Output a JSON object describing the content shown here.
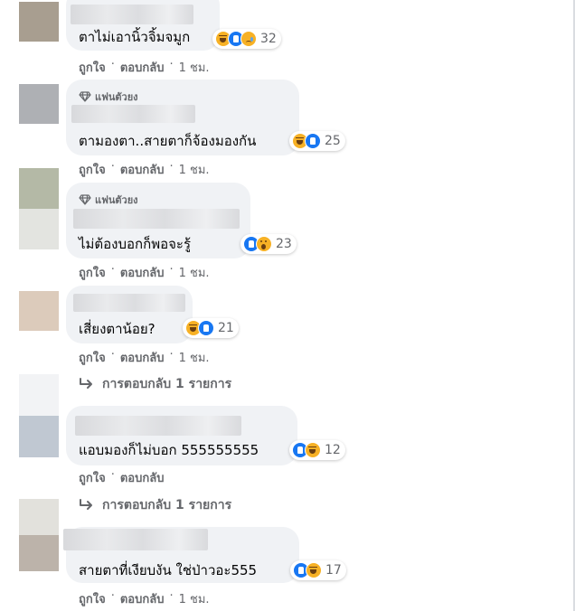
{
  "actions": {
    "like": "ถูกใจ",
    "reply": "ตอบกลับ",
    "separator": "·"
  },
  "comments": [
    {
      "text": "ตาไม่เอานิ้วจิ้มจมูก",
      "badge": "",
      "reactions": [
        "haha",
        "like",
        "sad"
      ],
      "reaction_count": "32",
      "time": "1 ชม.",
      "replies": "",
      "avatar_colors": [
        "#a89e90",
        "#a89e90"
      ]
    },
    {
      "text": "ตามองตา..สายตาก็จ้องมองกัน",
      "badge": "แฟนตัวยง",
      "reactions": [
        "haha",
        "like"
      ],
      "reaction_count": "25",
      "time": "1 ชม.",
      "replies": "",
      "avatar_colors": [
        "#aeb0b4",
        "#aeb0b4"
      ]
    },
    {
      "text": "ไม่ต้องบอกก็พอจะรู้",
      "badge": "แฟนตัวยง",
      "reactions": [
        "like",
        "wow"
      ],
      "reaction_count": "23",
      "time": "1 ชม.",
      "replies": "",
      "avatar_colors": [
        "#b4b9a6",
        "#e3e4e0"
      ]
    },
    {
      "text": "เสี่ยงตาน้อย?",
      "badge": "",
      "reactions": [
        "haha",
        "like"
      ],
      "reaction_count": "21",
      "time": "1 ชม.",
      "replies": "การตอบกลับ 1 รายการ",
      "avatar_colors": [
        "#dccbbb",
        "#dccbbb"
      ]
    },
    {
      "text": "แอบมองก็ไม่บอก 555555555",
      "badge": "",
      "reactions": [
        "like",
        "haha"
      ],
      "reaction_count": "12",
      "time": "",
      "replies": "การตอบกลับ 1 รายการ",
      "avatar_colors": [
        "#c0c8d2",
        "#c0c8d2"
      ]
    },
    {
      "text": "สายตาที่เงียบงัน ใช่ป่าวอะ555",
      "badge": "",
      "reactions": [
        "like",
        "haha"
      ],
      "reaction_count": "17",
      "time": "1 ชม.",
      "replies": "",
      "avatar_colors": [
        "#e2e1dc",
        "#bcb3aa"
      ]
    }
  ],
  "colors": {
    "bubble": "#f0f2f5",
    "secondary_text": "#65676b",
    "like_blue": "#1877f2",
    "reaction_yellow": "#f7b125"
  },
  "icons": {
    "badge": "diamond-icon",
    "replies": "reply-arrow-icon"
  }
}
